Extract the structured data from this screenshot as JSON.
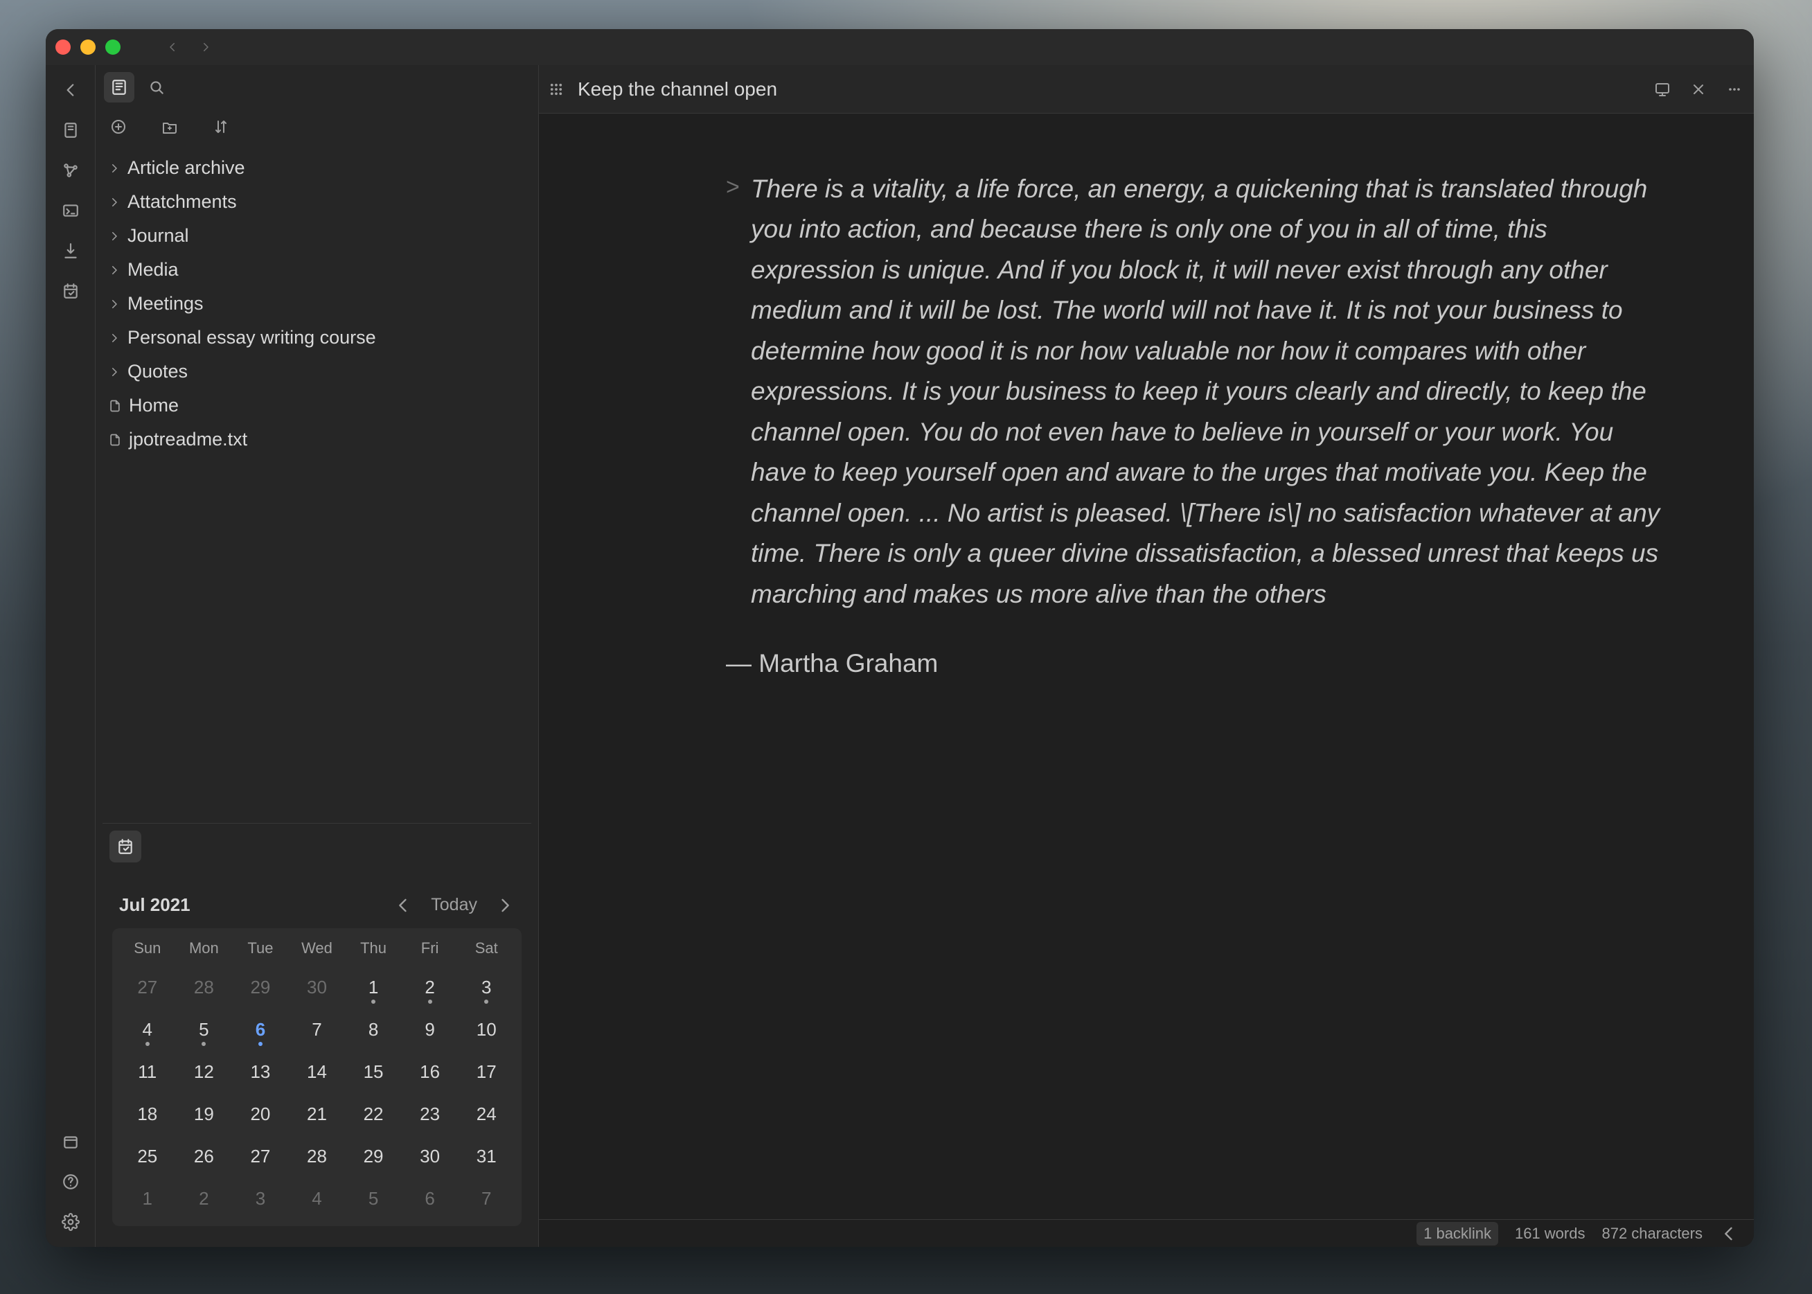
{
  "note_title": "Keep the channel open",
  "quote": "There is a vitality, a life force, an energy, a quickening that is translated through you into action, and because there is only one of you in all of time, this expression is unique. And if you block it, it will never exist through any other medium and it will be lost. The world will not have it. It is not your business to determine how good it is nor how valuable nor how it compares with other expressions. It is your business to keep it yours clearly and directly, to keep the channel open. You do not even have to believe in yourself or your work. You have to keep yourself open and aware to the urges that motivate you. Keep the channel open. ... No artist is pleased. \\[There is\\] no satisfaction whatever at any time. There is only a queer divine dissatisfaction, a blessed unrest that keeps us marching and makes us more alive than the others",
  "attribution": "— Martha Graham",
  "tree": [
    {
      "label": "Article archive",
      "type": "folder"
    },
    {
      "label": "Attatchments",
      "type": "folder"
    },
    {
      "label": "Journal",
      "type": "folder"
    },
    {
      "label": "Media",
      "type": "folder"
    },
    {
      "label": "Meetings",
      "type": "folder"
    },
    {
      "label": "Personal essay writing course",
      "type": "folder"
    },
    {
      "label": "Quotes",
      "type": "folder"
    },
    {
      "label": "Home",
      "type": "file"
    },
    {
      "label": "jpotreadme.txt",
      "type": "file"
    }
  ],
  "calendar": {
    "title": "Jul 2021",
    "today_label": "Today",
    "dow": [
      "Sun",
      "Mon",
      "Tue",
      "Wed",
      "Thu",
      "Fri",
      "Sat"
    ],
    "days": [
      {
        "n": 27,
        "dim": true
      },
      {
        "n": 28,
        "dim": true
      },
      {
        "n": 29,
        "dim": true
      },
      {
        "n": 30,
        "dim": true
      },
      {
        "n": 1,
        "mark": true
      },
      {
        "n": 2,
        "mark": true
      },
      {
        "n": 3,
        "mark": true
      },
      {
        "n": 4,
        "mark": true
      },
      {
        "n": 5,
        "mark": true
      },
      {
        "n": 6,
        "today": true,
        "mark": true
      },
      {
        "n": 7
      },
      {
        "n": 8
      },
      {
        "n": 9
      },
      {
        "n": 10
      },
      {
        "n": 11
      },
      {
        "n": 12
      },
      {
        "n": 13
      },
      {
        "n": 14
      },
      {
        "n": 15
      },
      {
        "n": 16
      },
      {
        "n": 17
      },
      {
        "n": 18
      },
      {
        "n": 19
      },
      {
        "n": 20
      },
      {
        "n": 21
      },
      {
        "n": 22
      },
      {
        "n": 23
      },
      {
        "n": 24
      },
      {
        "n": 25
      },
      {
        "n": 26
      },
      {
        "n": 27
      },
      {
        "n": 28
      },
      {
        "n": 29
      },
      {
        "n": 30
      },
      {
        "n": 31
      },
      {
        "n": 1,
        "dim": true
      },
      {
        "n": 2,
        "dim": true
      },
      {
        "n": 3,
        "dim": true
      },
      {
        "n": 4,
        "dim": true
      },
      {
        "n": 5,
        "dim": true
      },
      {
        "n": 6,
        "dim": true
      },
      {
        "n": 7,
        "dim": true
      }
    ]
  },
  "status": {
    "backlinks": "1 backlink",
    "words": "161 words",
    "chars": "872 characters"
  }
}
